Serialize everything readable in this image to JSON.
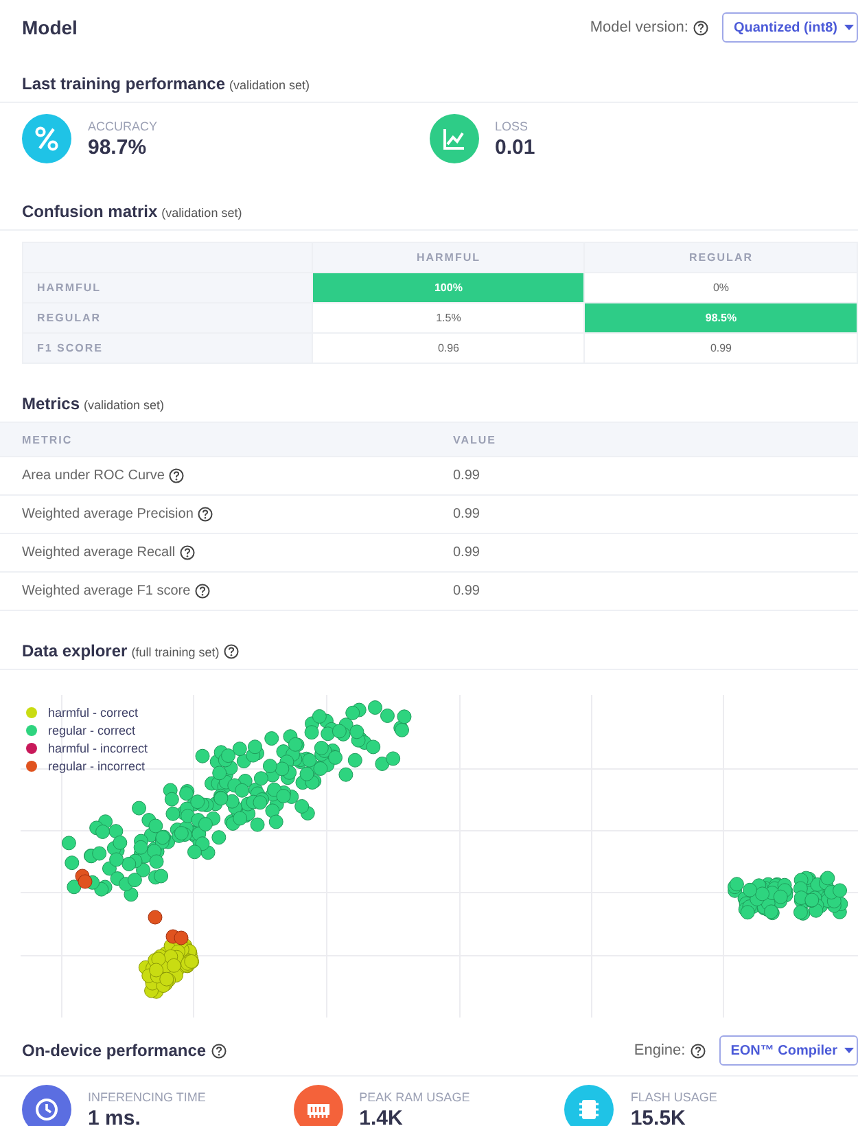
{
  "header": {
    "title": "Model",
    "version_label": "Model version:",
    "version_value": "Quantized (int8)"
  },
  "training": {
    "title": "Last training performance",
    "note": "(validation set)",
    "stats": [
      {
        "kind": "percent",
        "color": "#1fc3e6",
        "label": "ACCURACY",
        "value": "98.7%"
      },
      {
        "kind": "chart",
        "color": "#2ecc87",
        "label": "LOSS",
        "value": "0.01"
      }
    ]
  },
  "confusion": {
    "title": "Confusion matrix",
    "note": "(validation set)",
    "columns": [
      "HARMFUL",
      "REGULAR"
    ],
    "rows": [
      {
        "label": "HARMFUL",
        "cells": [
          {
            "value": "100%",
            "highlighted": true
          },
          {
            "value": "0%",
            "highlighted": false
          }
        ]
      },
      {
        "label": "REGULAR",
        "cells": [
          {
            "value": "1.5%",
            "highlighted": false
          },
          {
            "value": "98.5%",
            "highlighted": true
          }
        ]
      },
      {
        "label": "F1 SCORE",
        "cells": [
          {
            "value": "0.96",
            "highlighted": false
          },
          {
            "value": "0.99",
            "highlighted": false
          }
        ]
      }
    ]
  },
  "metrics": {
    "title": "Metrics",
    "note": "(validation set)",
    "columns": [
      "METRIC",
      "VALUE"
    ],
    "rows": [
      {
        "name": "Area under ROC Curve",
        "value": "0.99"
      },
      {
        "name": "Weighted average Precision",
        "value": "0.99"
      },
      {
        "name": "Weighted average Recall",
        "value": "0.99"
      },
      {
        "name": "Weighted average F1 score",
        "value": "0.99"
      }
    ]
  },
  "explorer": {
    "title": "Data explorer",
    "note": "(full training set)",
    "legend": [
      {
        "label": "harmful - correct",
        "color": "#c9dc12"
      },
      {
        "label": "regular - correct",
        "color": "#2ed47f"
      },
      {
        "label": "harmful - incorrect",
        "color": "#c8195a"
      },
      {
        "label": "regular - incorrect",
        "color": "#e0531f"
      }
    ]
  },
  "device": {
    "title": "On-device performance",
    "engine_label": "Engine:",
    "engine_value": "EON™ Compiler",
    "stats": [
      {
        "kind": "clock",
        "color": "#5b6ee1",
        "label": "INFERENCING TIME",
        "value": "1 ms."
      },
      {
        "kind": "memory",
        "color": "#f4623a",
        "label": "PEAK RAM USAGE",
        "value": "1.4K"
      },
      {
        "kind": "chip",
        "color": "#1fc3e6",
        "label": "FLASH USAGE",
        "value": "15.5K"
      }
    ]
  }
}
